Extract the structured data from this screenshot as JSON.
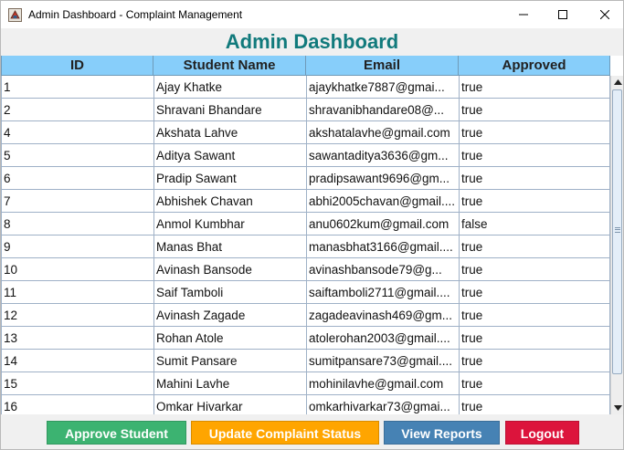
{
  "window": {
    "title": "Admin Dashboard - Complaint Management"
  },
  "heading": "Admin Dashboard",
  "table": {
    "headers": [
      "ID",
      "Student Name",
      "Email",
      "Approved"
    ],
    "rows": [
      [
        "1",
        "Ajay Khatke",
        "ajaykhatke7887@gmai...",
        "true"
      ],
      [
        "2",
        "Shravani Bhandare",
        "shravanibhandare08@...",
        "true"
      ],
      [
        "4",
        "Akshata Lahve",
        "akshatalavhe@gmail.com",
        "true"
      ],
      [
        "5",
        "Aditya Sawant",
        "sawantaditya3636@gm...",
        "true"
      ],
      [
        "6",
        "Pradip Sawant",
        "pradipsawant9696@gm...",
        "true"
      ],
      [
        "7",
        "Abhishek Chavan",
        "abhi2005chavan@gmail....",
        "true"
      ],
      [
        "8",
        "Anmol Kumbhar",
        "anu0602kum@gmail.com",
        "false"
      ],
      [
        "9",
        "Manas Bhat",
        "manasbhat3166@gmail....",
        "true"
      ],
      [
        "10",
        "Avinash Bansode",
        "avinashbansode79@g...",
        "true"
      ],
      [
        "11",
        "Saif Tamboli",
        "saiftamboli2711@gmail....",
        "true"
      ],
      [
        "12",
        "Avinash Zagade",
        "zagadeavinash469@gm...",
        "true"
      ],
      [
        "13",
        "Rohan Atole",
        "atolerohan2003@gmail....",
        "true"
      ],
      [
        "14",
        "Sumit Pansare",
        "sumitpansare73@gmail....",
        "true"
      ],
      [
        "15",
        "Mahini Lavhe",
        "mohinilavhe@gmail.com",
        "true"
      ],
      [
        "16",
        "Omkar Hivarkar",
        "omkarhivarkar73@gmai...",
        "true"
      ]
    ]
  },
  "buttons": {
    "approve": "Approve Student",
    "update": "Update Complaint Status",
    "reports": "View Reports",
    "logout": "Logout"
  },
  "colors": {
    "heading": "#117a7c",
    "header_bg": "#87cefa",
    "approve_bg": "#3cb371",
    "update_bg": "#ffa500",
    "reports_bg": "#4682b4",
    "logout_bg": "#dc143c"
  },
  "icons": {
    "app": "java-app-icon",
    "minimize": "minimize-icon",
    "maximize": "maximize-icon",
    "close": "close-icon",
    "scroll_up": "arrow-up-icon",
    "scroll_down": "arrow-down-icon"
  }
}
